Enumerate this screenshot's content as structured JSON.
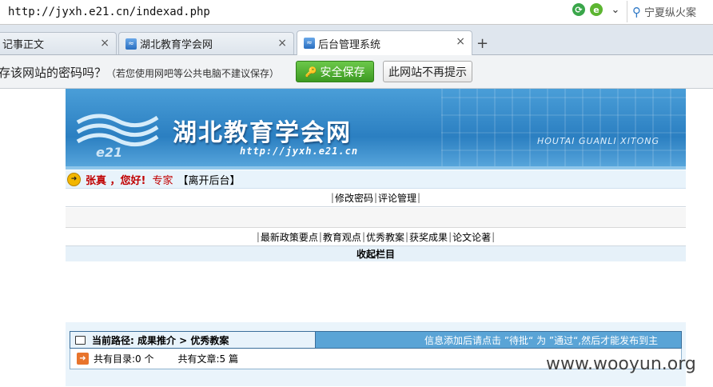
{
  "browser": {
    "url": "http://jyxh.e21.cn/indexad.php",
    "search_text": "宁夏纵火案",
    "tabs": [
      {
        "label": "记事正文",
        "active": false
      },
      {
        "label": "湖北教育学会网",
        "active": false
      },
      {
        "label": "后台管理系统",
        "active": true
      }
    ],
    "close_glyph": "×",
    "new_tab_glyph": "+"
  },
  "password_bar": {
    "question": "存该网站的密码吗？",
    "hint": "（若您使用网吧等公共电脑不建议保存）",
    "save_button": "安全保存",
    "never_button": "此网站不再提示"
  },
  "banner": {
    "title": "湖北教育学会网",
    "url": "http://jyxh.e21.cn",
    "logo_text": "e21",
    "subtitle": "HOUTAI GUANLI XITONG"
  },
  "welcome": {
    "user": "张真 ，您好!",
    "role": "专家",
    "logout": "【离开后台】"
  },
  "menu_top": [
    "修改密码",
    "评论管理"
  ],
  "menu_content": [
    "最新政策要点",
    "教育观点",
    "优秀教案",
    "获奖成果",
    "论文论著"
  ],
  "collapse_label": "收起栏目",
  "path_bar": {
    "label": "当前路径: 成果推介 > 优秀教案",
    "notice": "信息添加后请点击 ”待批“ 为 ”通过“,然后才能发布到主"
  },
  "counts": {
    "dirs_label": "共有目录:0 个",
    "articles_label": "共有文章:5 篇"
  },
  "watermark": "www.wooyun.org",
  "colors": {
    "banner_blue": "#2b7fc1",
    "save_green": "#3c9a22",
    "welcome_red": "#c00000",
    "path_blue": "#5aa4d6"
  }
}
